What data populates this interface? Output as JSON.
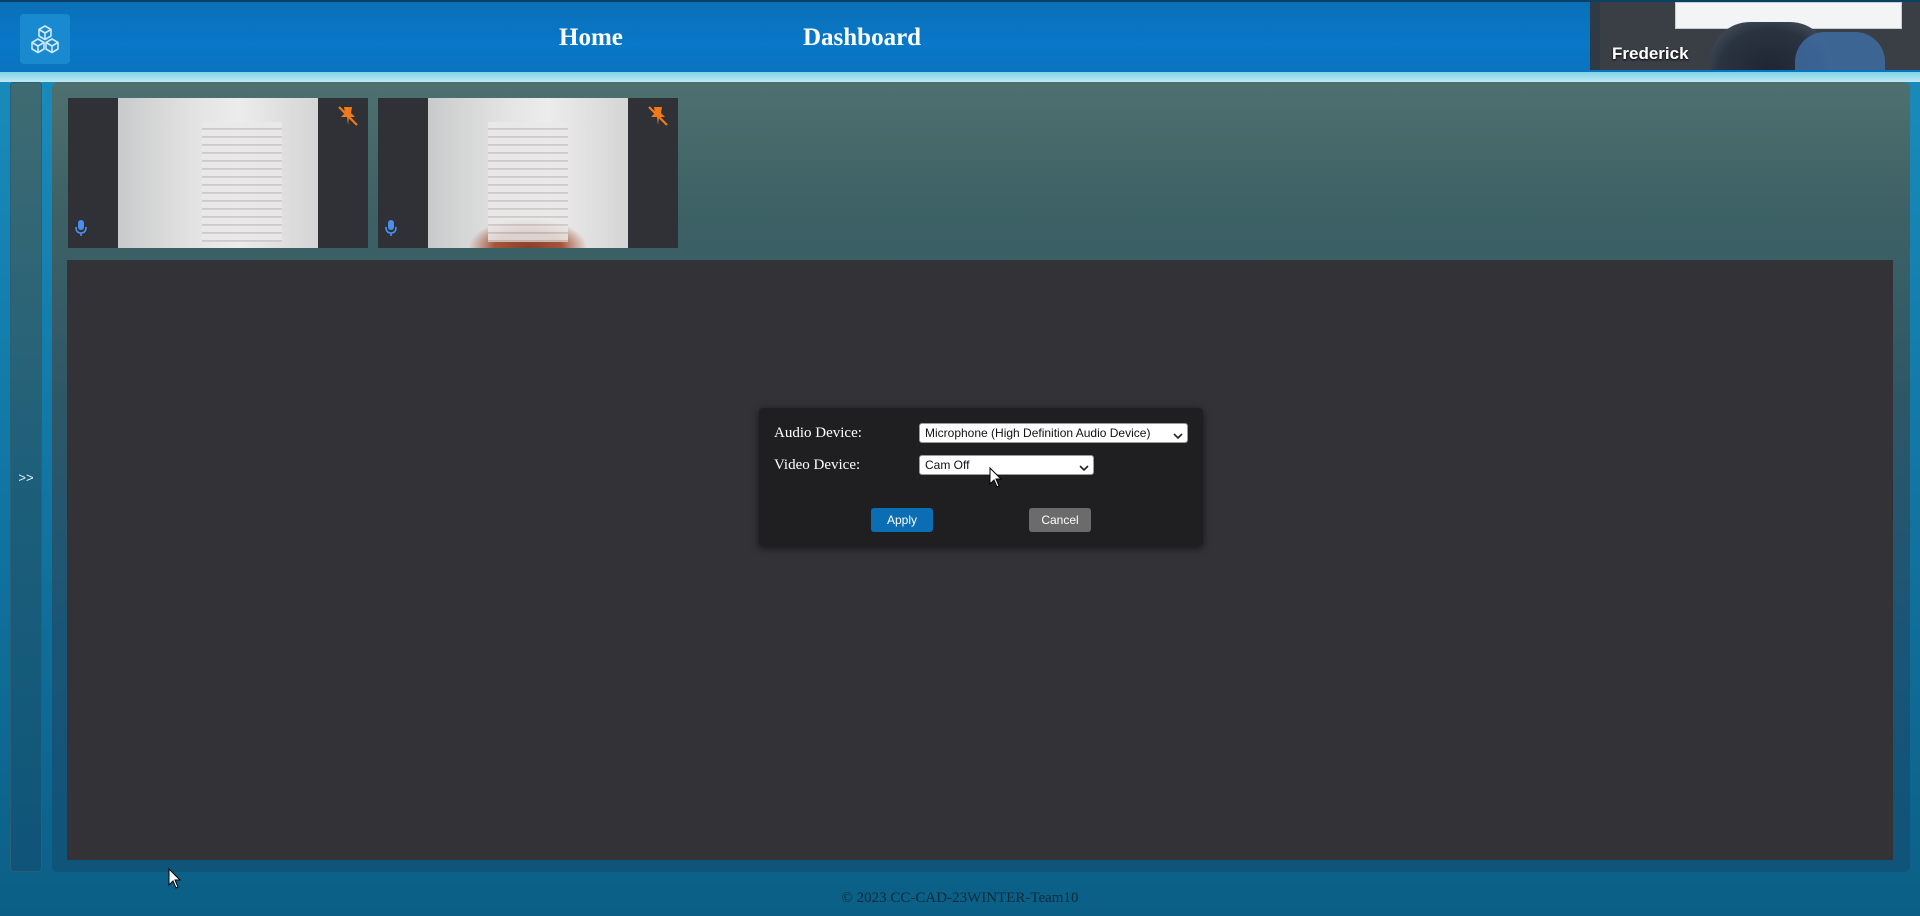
{
  "header": {
    "logo_icon": "cubes-icon",
    "nav": {
      "home": "Home",
      "dashboard": "Dashboard"
    },
    "self_view": {
      "name": "Frederick"
    }
  },
  "sidebar": {
    "toggle_label": ">>"
  },
  "participants": [
    {
      "icon_pin": "pin-off-icon",
      "icon_mic": "microphone-icon"
    },
    {
      "icon_pin": "pin-off-icon",
      "icon_mic": "microphone-icon"
    }
  ],
  "device_dialog": {
    "audio_label": "Audio Device:",
    "audio_value": "Microphone (High Definition Audio Device)",
    "video_label": "Video Device:",
    "video_value": "Cam Off",
    "apply_label": "Apply",
    "cancel_label": "Cancel"
  },
  "footer": {
    "copyright": "© 2023 CC-CAD-23WINTER-Team10"
  },
  "colors": {
    "header": "#0878c8",
    "apply_button": "#0b6db3",
    "cancel_button": "#6b6b6b",
    "pin_icon": "#f07a1a",
    "mic_icon": "#4a8ff0",
    "stage": "#333236"
  }
}
